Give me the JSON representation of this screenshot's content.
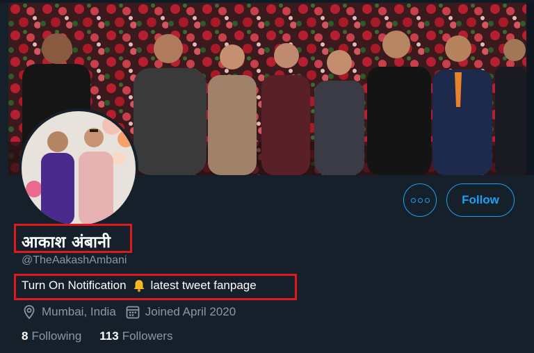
{
  "profile": {
    "display_name": "आकाश अंबानी",
    "handle": "@TheAakashAmbani",
    "bio_before": "Turn On Notification",
    "bio_after": "latest tweet fanpage",
    "location": "Mumbai, India",
    "joined": "Joined April 2020"
  },
  "actions": {
    "follow_label": "Follow"
  },
  "stats": {
    "following_count": "8",
    "following_label": "Following",
    "followers_count": "113",
    "followers_label": "Followers"
  },
  "icons": {
    "more": "more-dots-icon",
    "bell": "bell-icon",
    "location": "location-pin-icon",
    "calendar": "calendar-icon"
  },
  "colors": {
    "background": "#15202b",
    "accent": "#1da1f2",
    "highlight_border": "#e0191f",
    "secondary_text": "#8899a6"
  }
}
